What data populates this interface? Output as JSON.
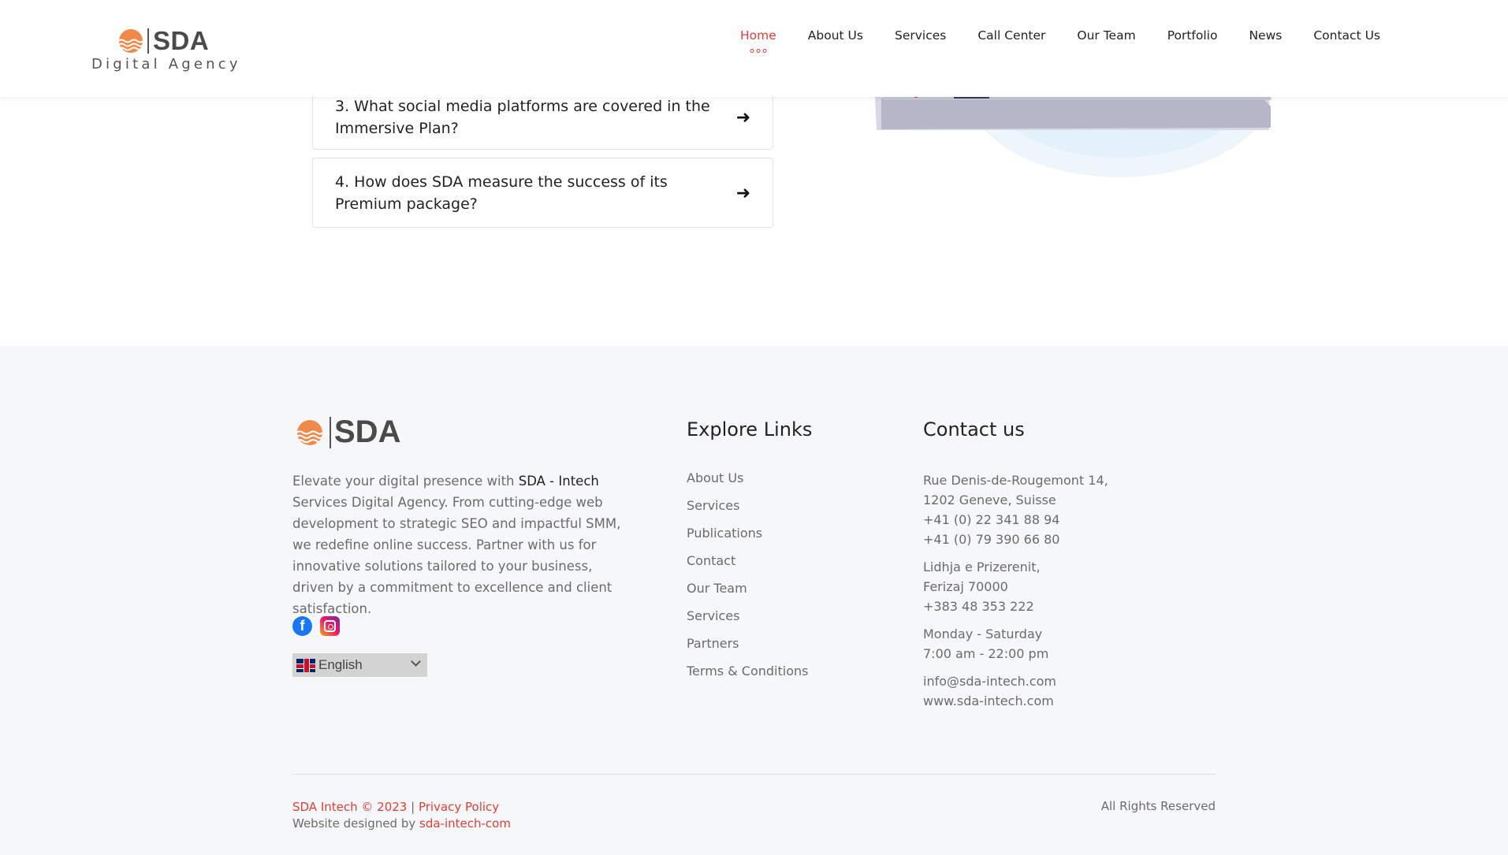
{
  "header": {
    "brand": "SDA",
    "tagline": "Digital Agency",
    "nav": [
      {
        "label": "Home",
        "active": true
      },
      {
        "label": "About Us"
      },
      {
        "label": "Services"
      },
      {
        "label": "Call Center"
      },
      {
        "label": "Our Team"
      },
      {
        "label": "Portfolio"
      },
      {
        "label": "News"
      },
      {
        "label": "Contact Us"
      }
    ]
  },
  "faq": [
    {
      "question": "3. What social media platforms are covered in the Immersive Plan?"
    },
    {
      "question": "4. How does SDA measure the success of its Premium package?"
    }
  ],
  "footer": {
    "brand": "SDA",
    "about_prefix": "Elevate your digital presence with ",
    "about_highlight": "SDA - Intech",
    "about_rest": " Services Digital Agency. From cutting-edge web development to strategic SEO and impactful SMM, we redefine online success. Partner with us for innovative solutions tailored to your business, driven by a commitment to excellence and client satisfaction.",
    "language": "English",
    "explore_title": "Explore Links",
    "explore_links": [
      "About Us",
      "Services",
      "Publications",
      "Contact",
      "Our Team",
      "Services",
      "Partners",
      "Terms & Conditions"
    ],
    "contact_title": "Contact us",
    "contact": {
      "address1_line1": "Rue Denis-de-Rougemont 14,",
      "address1_line2": "1202 Geneve, Suisse",
      "phone1": "+41 (0) 22 341 88 94",
      "phone2": "+41 (0) 79 390 66 80",
      "address2_line1": "Lidhja e Prizerenit,",
      "address2_line2": "Ferizaj 70000",
      "phone3": "+383 48 353 222",
      "hours_days": "Monday - Saturday",
      "hours_time": "7:00 am - 22:00 pm",
      "email": "info@sda-intech.com",
      "website": "www.sda-intech.com"
    },
    "copyright": "SDA Intech © 2023",
    "separator": " | ",
    "privacy": "Privacy Policy",
    "designed_by_label": "Website designed by ",
    "designed_by_link": "sda-intech-com",
    "rights": "All Rights Reserved"
  },
  "colors": {
    "accent": "#e03e36",
    "logo_orange": "#f08a4b",
    "footer_bg": "#f6f7f9"
  }
}
